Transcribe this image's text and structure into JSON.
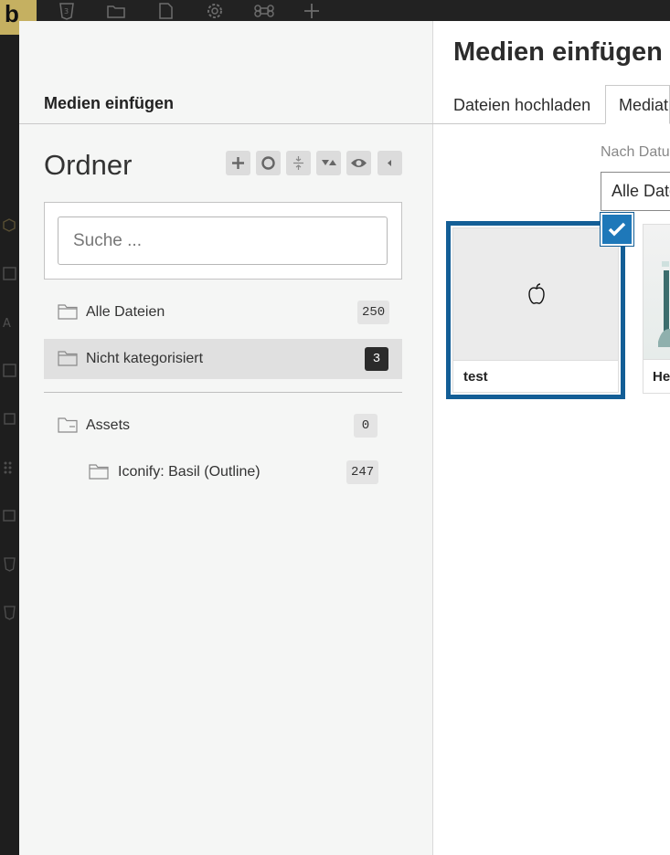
{
  "app": {
    "brand_letter": "b"
  },
  "modal": {
    "sidebar_title": "Medien einfügen",
    "title": "Medien einfügen",
    "tabs": [
      {
        "label": "Dateien hochladen"
      },
      {
        "label": "Mediathek"
      }
    ]
  },
  "folders": {
    "heading": "Ordner",
    "toolbar": [
      "add-icon",
      "circle-icon",
      "collapse-icon",
      "sort-icon",
      "eye-icon",
      "caret-left-icon"
    ],
    "search": {
      "placeholder": "Suche ...",
      "value": ""
    },
    "items": [
      {
        "label": "Alle Dateien",
        "count": "250",
        "active": false
      },
      {
        "label": "Nicht kategorisiert",
        "count": "3",
        "active": true
      },
      {
        "label": "Assets",
        "count": "0",
        "active": false
      },
      {
        "label": "Iconify: Basil (Outline)",
        "count": "247",
        "active": false
      }
    ]
  },
  "filter": {
    "label": "Nach Datum",
    "selected": "Alle Daten"
  },
  "attachments": [
    {
      "name": "test",
      "selected": true,
      "thumb_icon": "apple-icon"
    },
    {
      "name": "He",
      "selected": false
    }
  ],
  "colors": {
    "accent": "#135e96",
    "check": "#1e78b9",
    "brand": "#c5b061"
  }
}
